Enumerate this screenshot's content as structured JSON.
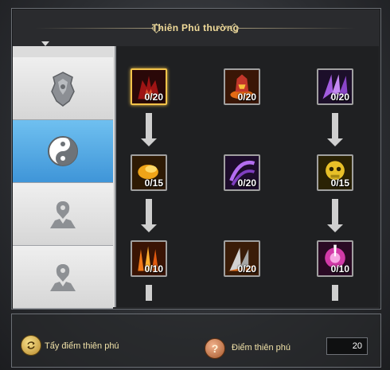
{
  "title": "Thiên Phú thường",
  "sidebar": {
    "tabs": [
      {
        "icon": "shield-crest-icon",
        "active": false
      },
      {
        "icon": "yin-yang-icon",
        "active": true
      },
      {
        "icon": "person-silhouette-icon",
        "active": false
      },
      {
        "icon": "person-silhouette-icon",
        "active": false
      }
    ]
  },
  "talents": [
    {
      "icon": "red-flame-demon-icon",
      "level": "0/20",
      "selected": true
    },
    {
      "icon": "fire-helm-icon",
      "level": "0/20",
      "selected": false
    },
    {
      "icon": "purple-claw-icon",
      "level": "0/20",
      "selected": false
    },
    {
      "icon": "golden-fist-icon",
      "level": "0/15",
      "selected": false
    },
    {
      "icon": "purple-slash-icon",
      "level": "0/20",
      "selected": false
    },
    {
      "icon": "golden-skull-icon",
      "level": "0/15",
      "selected": false
    },
    {
      "icon": "fire-claw-icon",
      "level": "0/10",
      "selected": false
    },
    {
      "icon": "blade-fan-icon",
      "level": "0/20",
      "selected": false
    },
    {
      "icon": "pink-orb-icon",
      "level": "0/10",
      "selected": false
    }
  ],
  "footer": {
    "reset_label": "Tẩy điểm thiên phú",
    "points_label": "Điểm thiên phú",
    "points_value": "20"
  },
  "colors": {
    "accent_gold": "#f2dc9a",
    "active_tab": "#3f95d8",
    "selected_border": "#f4c44a"
  }
}
